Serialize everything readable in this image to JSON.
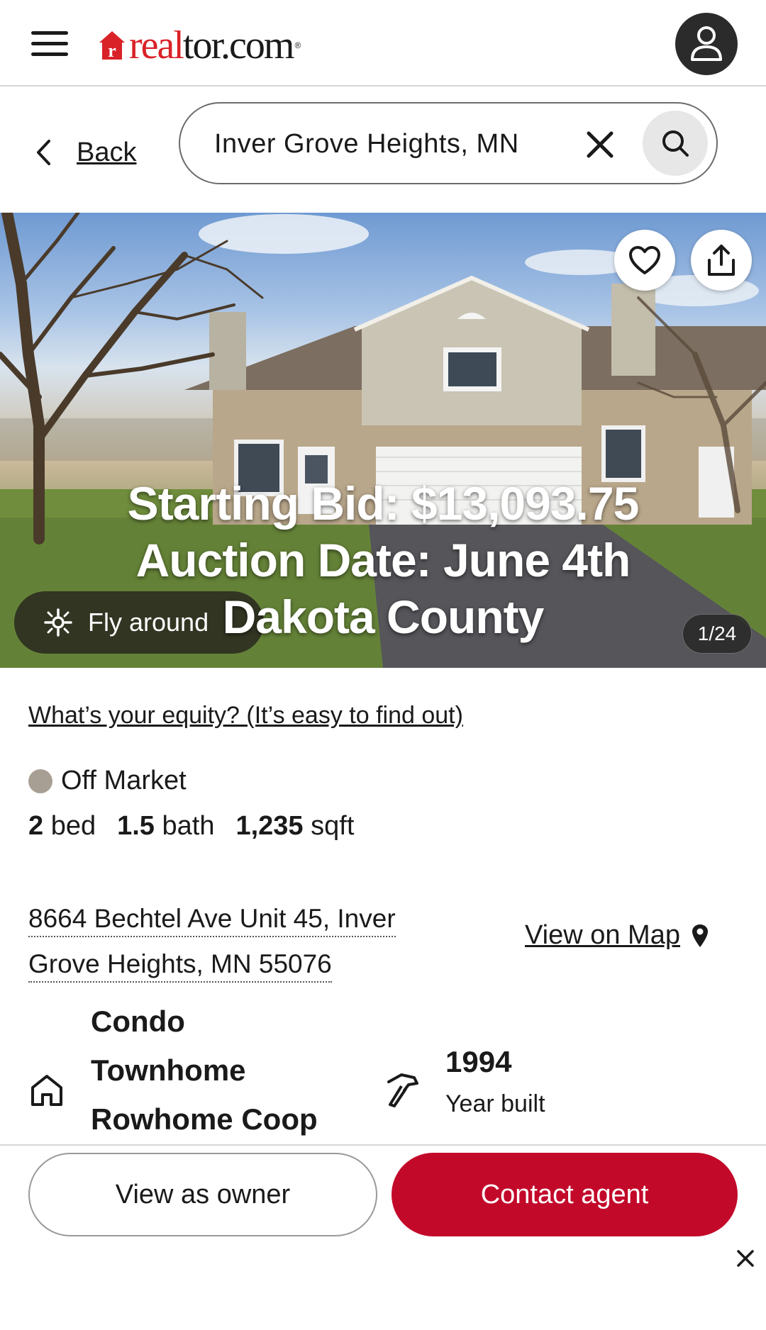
{
  "header": {
    "logo_text_red": "real",
    "logo_text_dark": "tor.com",
    "logo_reg": "®",
    "menu_icon": "hamburger-menu-icon",
    "account_icon": "user-avatar-icon"
  },
  "search": {
    "back_label": "Back",
    "value": "Inver Grove Heights, MN",
    "clear_icon": "close-icon",
    "search_icon": "search-icon"
  },
  "hero": {
    "overlay_line1": "Starting Bid: $13,093.75",
    "overlay_line2": "Auction Date: June 4th",
    "overlay_line3": "Dakota County",
    "fly_around_label": "Fly around",
    "photo_counter": "1/24",
    "favorite_icon": "heart-icon",
    "share_icon": "share-icon"
  },
  "details": {
    "equity_link": "What’s your equity? (It’s easy to find out)",
    "status": "Off Market",
    "status_color": "#a89f94",
    "beds_value": "2",
    "beds_unit": "bed",
    "baths_value": "1.5",
    "baths_unit": "bath",
    "sqft_value": "1,235",
    "sqft_unit": "sqft",
    "address_line1": "8664 Bechtel Ave Unit 45, Inver",
    "address_line2": "Grove Heights, MN 55076",
    "view_on_map": "View on Map",
    "property_type_line1": "Condo",
    "property_type_line2": "Townhome",
    "property_type_line3": "Rowhome Coop",
    "year_built_value": "1994",
    "year_built_label": "Year built"
  },
  "actions": {
    "view_as_owner": "View as owner",
    "contact_agent": "Contact agent",
    "accent_color": "#c3092a"
  }
}
